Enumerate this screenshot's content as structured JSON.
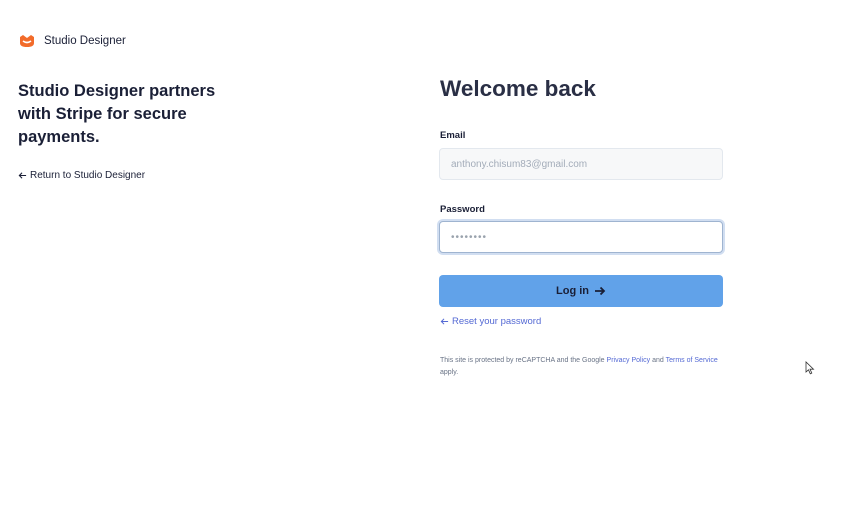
{
  "brand": {
    "name": "Studio Designer",
    "logo_icon": "studio-designer-logo-icon",
    "logo_color": "#f26b2a"
  },
  "promo": {
    "text": "Studio Designer partners with Stripe for secure payments.",
    "return_link": "Return to Studio Designer"
  },
  "login": {
    "title": "Welcome back",
    "email_label": "Email",
    "email_value": "anthony.chisum83@gmail.com",
    "password_label": "Password",
    "password_value": "••••••••",
    "submit_label": "Log in",
    "reset_link": "Reset your password",
    "button_color": "#61a2e9",
    "link_color": "#5469d4"
  },
  "recaptcha": {
    "prefix": "This site is protected by reCAPTCHA and the Google",
    "privacy_link": "Privacy Policy",
    "and": "and",
    "terms_link": "Terms of Service",
    "suffix": "apply."
  }
}
